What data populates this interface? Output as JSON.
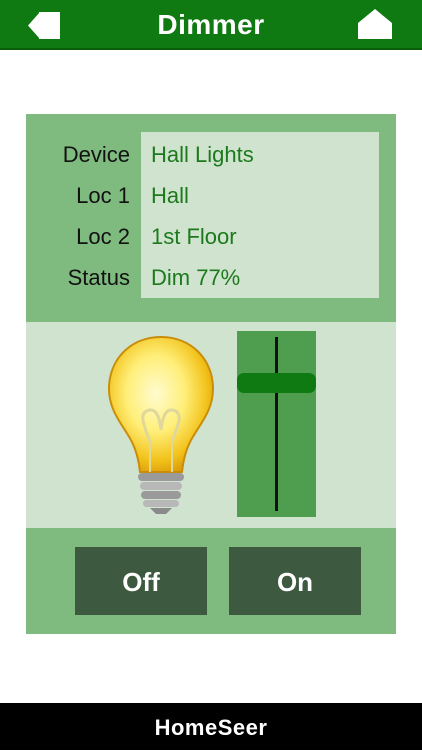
{
  "header": {
    "title": "Dimmer",
    "back_icon": "back-arrow-icon",
    "home_icon": "home-icon"
  },
  "device": {
    "rows": [
      {
        "label": "Device",
        "value": "Hall Lights"
      },
      {
        "label": "Loc 1",
        "value": "Hall"
      },
      {
        "label": "Loc 2",
        "value": "1st Floor"
      },
      {
        "label": "Status",
        "value": "Dim 77%"
      }
    ]
  },
  "dimmer": {
    "level_percent": 77,
    "bulb_icon": "light-bulb-icon"
  },
  "buttons": {
    "off_label": "Off",
    "on_label": "On"
  },
  "footer": {
    "logo": "HomeSeer"
  },
  "colors": {
    "header_green": "#0f7a12",
    "panel_green": "#7fbb7f",
    "light_green": "#cfe3cf",
    "value_green": "#1c7a1c",
    "button_dark": "#3d5a40",
    "slider_green": "#4f9d4f"
  }
}
